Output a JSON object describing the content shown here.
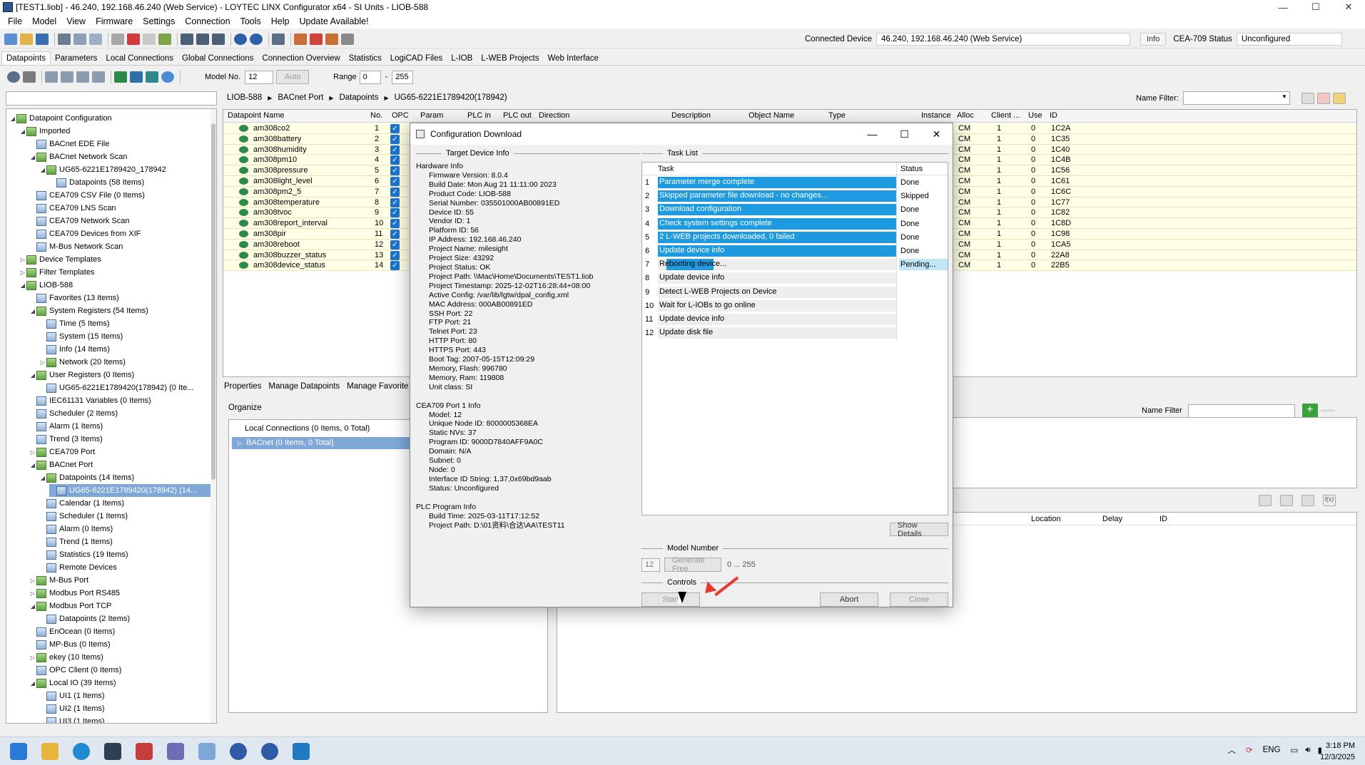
{
  "window": {
    "title": "[TEST1.liob] - 46.240, 192.168.46.240 (Web Service) - LOYTEC LINX Configurator x64 - SI Units - LIOB-588"
  },
  "menu": [
    "File",
    "Model",
    "View",
    "Firmware",
    "Settings",
    "Connection",
    "Tools",
    "Help",
    "Update Available!"
  ],
  "connection": {
    "label": "Connected Device",
    "value": "46.240, 192.168.46.240 (Web Service)",
    "info_btn": "Info",
    "cea_label": "CEA-709 Status",
    "cea_value": "Unconfigured"
  },
  "tabs": [
    "Datapoints",
    "Parameters",
    "Local Connections",
    "Global Connections",
    "Connection Overview",
    "Statistics",
    "LogiCAD Files",
    "L-IOB",
    "L-WEB Projects",
    "Web Interface"
  ],
  "toolbar2": {
    "model_label": "Model No.",
    "model_value": "12",
    "auto_btn": "Auto",
    "range_label": "Range",
    "range_from": "0",
    "range_dash": "-",
    "range_to": "255"
  },
  "tree": [
    {
      "d": 0,
      "a": "◢",
      "t": "Datapoint Configuration"
    },
    {
      "d": 1,
      "a": "◢",
      "t": "Imported"
    },
    {
      "d": 2,
      "a": "",
      "t": "BACnet EDE File"
    },
    {
      "d": 2,
      "a": "◢",
      "t": "BACnet Network Scan"
    },
    {
      "d": 3,
      "a": "◢",
      "t": "UG65-6221E1789420_178942"
    },
    {
      "d": 4,
      "a": "",
      "t": "Datapoints (58 Items)"
    },
    {
      "d": 2,
      "a": "",
      "t": "CEA709 CSV File (0 Items)"
    },
    {
      "d": 2,
      "a": "",
      "t": "CEA709 LNS Scan"
    },
    {
      "d": 2,
      "a": "",
      "t": "CEA709 Network Scan"
    },
    {
      "d": 2,
      "a": "",
      "t": "CEA709 Devices from XIF"
    },
    {
      "d": 2,
      "a": "",
      "t": "M-Bus Network Scan"
    },
    {
      "d": 1,
      "a": "▷",
      "t": "Device Templates"
    },
    {
      "d": 1,
      "a": "▷",
      "t": "Filter Templates"
    },
    {
      "d": 1,
      "a": "◢",
      "t": "LIOB-588"
    },
    {
      "d": 2,
      "a": "",
      "t": "Favorites (13 Items)"
    },
    {
      "d": 2,
      "a": "◢",
      "t": "System Registers (54 Items)"
    },
    {
      "d": 3,
      "a": "",
      "t": "Time (5 Items)"
    },
    {
      "d": 3,
      "a": "",
      "t": "System (15 Items)"
    },
    {
      "d": 3,
      "a": "",
      "t": "Info (14 Items)"
    },
    {
      "d": 3,
      "a": "▷",
      "t": "Network (20 Items)"
    },
    {
      "d": 2,
      "a": "◢",
      "t": "User Registers (0 Items)"
    },
    {
      "d": 3,
      "a": "",
      "t": "UG65-6221E1789420(178942) (0 Ite..."
    },
    {
      "d": 2,
      "a": "",
      "t": "IEC61131 Variables (0 Items)"
    },
    {
      "d": 2,
      "a": "",
      "t": "Scheduler (2 Items)"
    },
    {
      "d": 2,
      "a": "",
      "t": "Alarm (1 Items)"
    },
    {
      "d": 2,
      "a": "",
      "t": "Trend (3 Items)"
    },
    {
      "d": 2,
      "a": "▷",
      "t": "CEA709 Port"
    },
    {
      "d": 2,
      "a": "◢",
      "t": "BACnet Port"
    },
    {
      "d": 3,
      "a": "◢",
      "t": "Datapoints (14 Items)"
    },
    {
      "d": 4,
      "a": "",
      "t": "UG65-6221E1789420(178942) (14...",
      "sel": true
    },
    {
      "d": 3,
      "a": "",
      "t": "Calendar (1 Items)"
    },
    {
      "d": 3,
      "a": "",
      "t": "Scheduler (1 Items)"
    },
    {
      "d": 3,
      "a": "",
      "t": "Alarm (0 Items)"
    },
    {
      "d": 3,
      "a": "",
      "t": "Trend (1 Items)"
    },
    {
      "d": 3,
      "a": "",
      "t": "Statistics (19 Items)"
    },
    {
      "d": 3,
      "a": "",
      "t": "Remote Devices"
    },
    {
      "d": 2,
      "a": "▷",
      "t": "M-Bus Port"
    },
    {
      "d": 2,
      "a": "▷",
      "t": "Modbus Port RS485"
    },
    {
      "d": 2,
      "a": "◢",
      "t": "Modbus Port TCP"
    },
    {
      "d": 3,
      "a": "",
      "t": "Datapoints (2 Items)"
    },
    {
      "d": 2,
      "a": "",
      "t": "EnOcean (0 Items)"
    },
    {
      "d": 2,
      "a": "",
      "t": "MP-Bus (0 Items)"
    },
    {
      "d": 2,
      "a": "▷",
      "t": "ekey (10 Items)"
    },
    {
      "d": 2,
      "a": "",
      "t": "OPC Client (0 Items)"
    },
    {
      "d": 2,
      "a": "◢",
      "t": "Local IO (39 Items)"
    },
    {
      "d": 3,
      "a": "",
      "t": "UI1 (1 Items)"
    },
    {
      "d": 3,
      "a": "",
      "t": "UI2 (1 Items)"
    },
    {
      "d": 3,
      "a": "",
      "t": "UI3 (1 Items)"
    }
  ],
  "breadcrumb": [
    "LIOB-588",
    "▶",
    "BACnet Port",
    "▶",
    "Datapoints",
    "▶",
    "UG65-6221E1789420(178942)"
  ],
  "name_filter_label": "Name Filter:",
  "grid": {
    "headers": [
      "Datapoint Name",
      "No.",
      "OPC",
      "Param",
      "PLC in",
      "PLC out",
      "Direction",
      "Description",
      "Object Name",
      "Type",
      "Instance",
      "Alloc",
      "Client ...",
      "Use",
      "ID"
    ],
    "rows": [
      {
        "name": "am308co2",
        "no": "1",
        "alloc": "CM",
        "client": "1",
        "use": "0",
        "id": "1C2A"
      },
      {
        "name": "am308battery",
        "no": "2",
        "alloc": "CM",
        "client": "1",
        "use": "0",
        "id": "1C35"
      },
      {
        "name": "am308humidity",
        "no": "3",
        "alloc": "CM",
        "client": "1",
        "use": "0",
        "id": "1C40"
      },
      {
        "name": "am308pm10",
        "no": "4",
        "alloc": "CM",
        "client": "1",
        "use": "0",
        "id": "1C4B"
      },
      {
        "name": "am308pressure",
        "no": "5",
        "alloc": "CM",
        "client": "1",
        "use": "0",
        "id": "1C56"
      },
      {
        "name": "am308light_level",
        "no": "6",
        "alloc": "CM",
        "client": "1",
        "use": "0",
        "id": "1C61"
      },
      {
        "name": "am308pm2_5",
        "no": "7",
        "alloc": "CM",
        "client": "1",
        "use": "0",
        "id": "1C6C"
      },
      {
        "name": "am308temperature",
        "no": "8",
        "alloc": "CM",
        "client": "1",
        "use": "0",
        "id": "1C77"
      },
      {
        "name": "am308tvoc",
        "no": "9",
        "alloc": "CM",
        "client": "1",
        "use": "0",
        "id": "1C82"
      },
      {
        "name": "am308report_interval",
        "no": "10",
        "alloc": "CM",
        "client": "1",
        "use": "0",
        "id": "1C8D"
      },
      {
        "name": "am308pir",
        "no": "11",
        "alloc": "CM",
        "client": "1",
        "use": "0",
        "id": "1C98"
      },
      {
        "name": "am308reboot",
        "no": "12",
        "alloc": "CM",
        "client": "1",
        "use": "0",
        "id": "1CA5"
      },
      {
        "name": "am308buzzer_status",
        "no": "13",
        "alloc": "CM",
        "client": "1",
        "use": "0",
        "id": "22A8"
      },
      {
        "name": "am308device_status",
        "no": "14",
        "alloc": "CM",
        "client": "1",
        "use": "0",
        "id": "22B5"
      }
    ]
  },
  "lower": {
    "tabs": [
      "Properties",
      "Manage Datapoints",
      "Manage Favorite"
    ],
    "organize": "Organize",
    "org_items": [
      "Local Connections (0 Items, 0 Total)",
      "BACnet (0 Items, 0 Total)"
    ],
    "name_filter": "Name Filter",
    "cols": [
      "Location",
      "Delay",
      "ID"
    ]
  },
  "dialog": {
    "title": "Configuration Download",
    "target_hdr": "Target Device Info",
    "task_hdr": "Task List",
    "info": [
      {
        "h": "Hardware Info"
      },
      {
        "i": "Firmware Version: 8.0.4"
      },
      {
        "i": "Build Date: Mon Aug 21 11:11:00 2023"
      },
      {
        "i": "Product Code: LIOB-588"
      },
      {
        "i": "Serial Number: 035501000AB00891ED"
      },
      {
        "i": "Device ID: 55"
      },
      {
        "i": "Vendor ID: 1"
      },
      {
        "i": "Platform ID: 56"
      },
      {
        "i": "IP Address: 192.168.46.240"
      },
      {
        "i": "Project Name: milesight"
      },
      {
        "i": "Project Size: 43292"
      },
      {
        "i": "Project Status: OK"
      },
      {
        "i": "Project Path: \\\\Mac\\Home\\Documents\\TEST1.liob"
      },
      {
        "i": "Project Timestamp: 2025-12-02T16:28:44+08:00"
      },
      {
        "i": "Active Config: /var/lib/lgtw/dpal_config.xml"
      },
      {
        "i": "MAC Address: 000AB00891ED"
      },
      {
        "i": "SSH Port: 22"
      },
      {
        "i": "FTP Port: 21"
      },
      {
        "i": "Telnet Port: 23"
      },
      {
        "i": "HTTP Port: 80"
      },
      {
        "i": "HTTPS Port: 443"
      },
      {
        "i": "Boot Tag: 2007-05-15T12:09:29"
      },
      {
        "i": "Memory, Flash: 996780"
      },
      {
        "i": "Memory, Ram: 119808"
      },
      {
        "i": "Unit class: SI"
      },
      {
        "g": ""
      },
      {
        "h": "CEA709 Port 1 Info"
      },
      {
        "i": "Model: 12"
      },
      {
        "i": "Unique Node ID: 8000005368EA"
      },
      {
        "i": "Static NVs: 37"
      },
      {
        "i": "Program ID: 9000D7840AFF9A0C"
      },
      {
        "i": "Domain: N/A"
      },
      {
        "i": "Subnet: 0"
      },
      {
        "i": "Node: 0"
      },
      {
        "i": "Interface ID String: 1,37,0x69bd9aab"
      },
      {
        "i": "Status: Unconfigured"
      },
      {
        "g": ""
      },
      {
        "h": "PLC Program Info"
      },
      {
        "i": "Build Time: 2025-03-11T17:12:52"
      },
      {
        "i": "Project Path: D:\\01资料\\合达\\AA\\TEST11"
      }
    ],
    "task_cols": [
      "Task",
      "Status"
    ],
    "tasks": [
      {
        "n": "1",
        "t": "Parameter merge complete",
        "s": "Done",
        "done": true
      },
      {
        "n": "2",
        "t": "Skipped parameter file download - no changes...",
        "s": "Skipped",
        "done": true
      },
      {
        "n": "3",
        "t": "Download configuration",
        "s": "Done",
        "done": true
      },
      {
        "n": "4",
        "t": "Check system settings complete",
        "s": "Done",
        "done": true
      },
      {
        "n": "5",
        "t": "2 L-WEB projects downloaded, 0 failed",
        "s": "Done",
        "done": true
      },
      {
        "n": "6",
        "t": "Update device info",
        "s": "Done",
        "done": true
      },
      {
        "n": "7",
        "t": "Rebooting device...",
        "s": "Pending...",
        "active": true
      },
      {
        "n": "8",
        "t": "Update device info",
        "s": ""
      },
      {
        "n": "9",
        "t": "Detect L-WEB Projects on Device",
        "s": ""
      },
      {
        "n": "10",
        "t": "Wait for L-IOBs to go online",
        "s": ""
      },
      {
        "n": "11",
        "t": "Update device info",
        "s": ""
      },
      {
        "n": "12",
        "t": "Update disk file",
        "s": ""
      }
    ],
    "show_details": "Show Details",
    "model_hdr": "Model Number",
    "model_value": "12",
    "generate_free": "Generate Free",
    "range_text": "0 ... 255",
    "controls_hdr": "Controls",
    "start": "Start",
    "abort": "Abort",
    "close": "Close"
  },
  "taskbar": {
    "lang": "ENG",
    "time": "3:18 PM",
    "date": "12/3/2025"
  }
}
